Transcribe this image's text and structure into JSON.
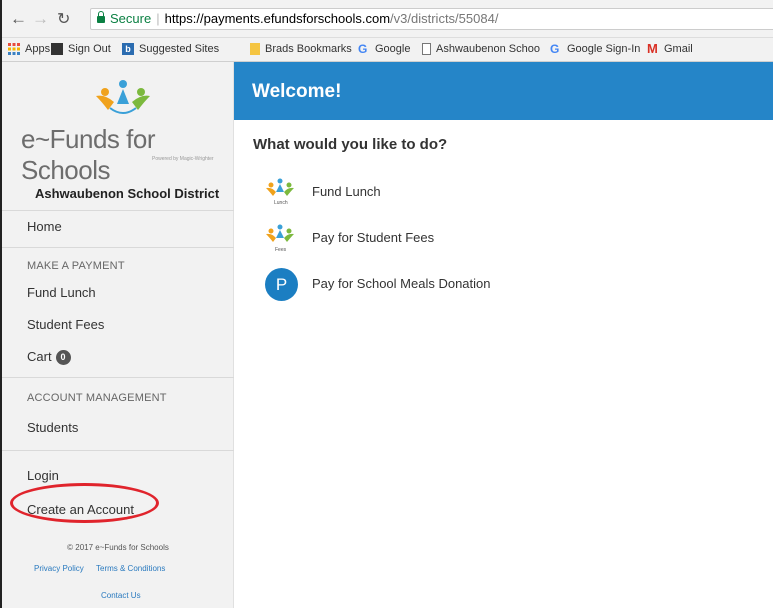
{
  "browser": {
    "secure_label": "Secure",
    "url_host": "https://payments.efundsforschools.com",
    "url_path": "/v3/districts/55084/",
    "bookmarks": [
      {
        "label": "Apps",
        "icon": "apps-grid-icon"
      },
      {
        "label": "Sign Out",
        "icon": "signout-icon"
      },
      {
        "label": "Suggested Sites",
        "icon": "bing-icon"
      },
      {
        "label": "Brads Bookmarks",
        "icon": "folder-icon"
      },
      {
        "label": "Google",
        "icon": "google-icon"
      },
      {
        "label": "Ashwaubenon Schoo",
        "icon": "page-icon"
      },
      {
        "label": "Google Sign-In",
        "icon": "google-icon"
      },
      {
        "label": "Gmail",
        "icon": "gmail-icon"
      }
    ]
  },
  "sidebar": {
    "brand": "e~Funds for Schools",
    "tagline": "Powered by Magic-Wrighter",
    "district": "Ashwaubenon School District",
    "home": "Home",
    "make_payment_header": "MAKE A PAYMENT",
    "fund_lunch": "Fund Lunch",
    "student_fees": "Student Fees",
    "cart": "Cart",
    "cart_count": "0",
    "account_header": "ACCOUNT MANAGEMENT",
    "students": "Students",
    "login": "Login",
    "create_account": "Create an Account",
    "copyright": "© 2017 e~Funds for Schools",
    "privacy": "Privacy Policy",
    "terms": "Terms & Conditions",
    "contact": "Contact Us"
  },
  "main": {
    "welcome": "Welcome!",
    "question": "What would you like to do?",
    "actions": [
      {
        "label": "Fund Lunch",
        "icon_caption": "Lunch",
        "icon": "lunch-kids-icon"
      },
      {
        "label": "Pay for Student Fees",
        "icon_caption": "Fees",
        "icon": "fees-kids-icon"
      },
      {
        "label": "Pay for School Meals Donation",
        "icon_letter": "P",
        "icon": "letter-p-icon"
      }
    ]
  },
  "colors": {
    "header_blue": "#2585c8",
    "highlight_red": "#e0242c",
    "sidebar_bg": "#f2f2f2"
  }
}
